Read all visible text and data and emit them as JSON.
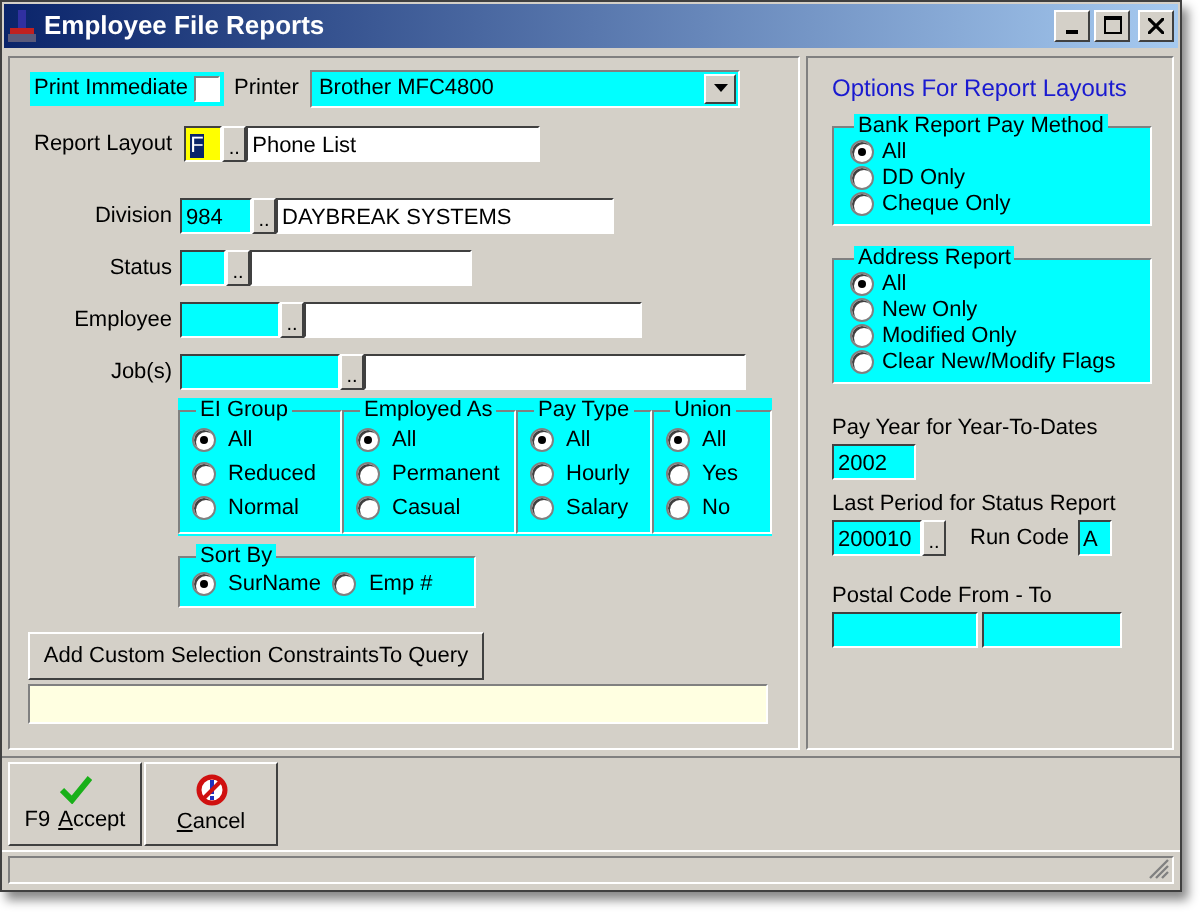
{
  "window": {
    "title": "Employee File Reports"
  },
  "print_immediate": {
    "label": "Print Immediate",
    "checked": false
  },
  "printer": {
    "label": "Printer",
    "value": "Brother MFC4800"
  },
  "report_layout": {
    "label": "Report Layout",
    "code": "F",
    "browse": "..",
    "name": "Phone List"
  },
  "lookups": [
    {
      "label": "Division",
      "code": "984",
      "browse": "..",
      "name": "DAYBREAK SYSTEMS"
    },
    {
      "label": "Status",
      "browse": ".."
    },
    {
      "label": "Employee",
      "browse": ".."
    },
    {
      "label": "Job(s)",
      "browse": ".."
    }
  ],
  "radio_groups": [
    {
      "title": "EI Group",
      "options": [
        {
          "label": "All",
          "selected": true
        },
        {
          "label": "Reduced",
          "selected": false
        },
        {
          "label": "Normal",
          "selected": false
        }
      ]
    },
    {
      "title": "Employed As",
      "options": [
        {
          "label": "All",
          "selected": true
        },
        {
          "label": "Permanent",
          "selected": false
        },
        {
          "label": "Casual",
          "selected": false
        }
      ]
    },
    {
      "title": "Pay Type",
      "options": [
        {
          "label": "All",
          "selected": true
        },
        {
          "label": "Hourly",
          "selected": false
        },
        {
          "label": "Salary",
          "selected": false
        }
      ]
    },
    {
      "title": "Union",
      "options": [
        {
          "label": "All",
          "selected": true
        },
        {
          "label": "Yes",
          "selected": false
        },
        {
          "label": "No",
          "selected": false
        }
      ]
    }
  ],
  "sort_by": {
    "title": "Sort By",
    "options": [
      {
        "label": "SurName",
        "selected": true
      },
      {
        "label": "Emp #",
        "selected": false
      }
    ]
  },
  "custom_button": "Add Custom Selection ConstraintsTo Query",
  "options": {
    "title": "Options For Report Layouts",
    "groups": [
      {
        "title": "Bank Report Pay Method",
        "options": [
          {
            "label": "All",
            "selected": true
          },
          {
            "label": "DD Only",
            "selected": false
          },
          {
            "label": "Cheque Only",
            "selected": false
          }
        ]
      },
      {
        "title": "Address Report",
        "options": [
          {
            "label": "All",
            "selected": true
          },
          {
            "label": "New Only",
            "selected": false
          },
          {
            "label": "Modified Only",
            "selected": false
          },
          {
            "label": "Clear New/Modify Flags",
            "selected": false
          }
        ]
      }
    ],
    "pay_year": {
      "label": "Pay Year for Year-To-Dates",
      "value": "2002"
    },
    "last_period": {
      "label": "Last Period for Status Report",
      "value": "200010",
      "browse": ".."
    },
    "run_code": {
      "label": "Run Code",
      "value": "A"
    },
    "postal_code": {
      "label": "Postal Code From - To"
    }
  },
  "toolbar": [
    {
      "kind": "accept",
      "key": "F9",
      "label": "Accept"
    },
    {
      "kind": "cancel",
      "label": "Cancel"
    }
  ]
}
